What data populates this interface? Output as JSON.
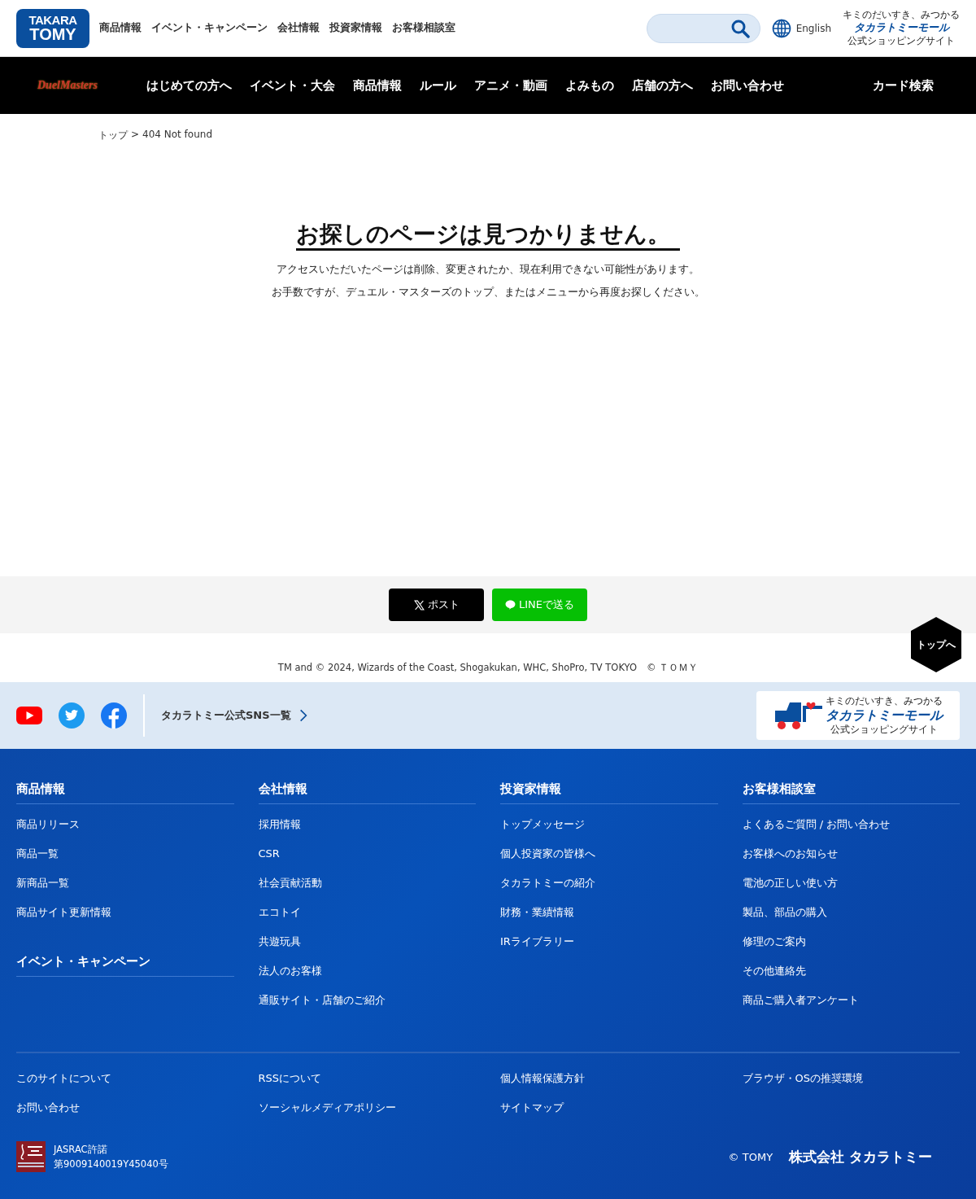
{
  "header": {
    "logo": [
      "TAKARA",
      "TOMY"
    ],
    "nav": [
      "商品情報",
      "イベント・キャンペーン",
      "会社情報",
      "投資家情報",
      "お客様相談室"
    ],
    "language": "English",
    "mall_logo": {
      "tagline": "キミのだいすき、みつかる",
      "name": "タカラトミーモール",
      "sub": "公式ショッピングサイト"
    }
  },
  "main_nav": {
    "logo": "DuelMasters",
    "items": [
      "はじめての方へ",
      "イベント・大会",
      "商品情報",
      "ルール",
      "アニメ・動画",
      "よみもの",
      "店舗の方へ",
      "お問い合わせ"
    ],
    "card_search": "カード検索"
  },
  "breadcrumb": {
    "items": [
      "トップ",
      "404 Not found"
    ],
    "separator": ">"
  },
  "error": {
    "title": "お探しのページは見つかりません。",
    "lines": [
      "アクセスいただいたページは削除、変更されたか、現在利用できない可能性があります。",
      "お手数ですが、デュエル・マスターズのトップ、またはメニューから再度お探しください。"
    ]
  },
  "share": [
    {
      "kind": "x",
      "label": "ポスト"
    },
    {
      "kind": "line",
      "label": "LINEで送る"
    }
  ],
  "back_to_top": "トップへ",
  "copyright": "TM and © 2024, Wizards of the Coast, Shogakukan, WHC, ShoPro, TV TOKYO　© ＴＯＭＹ",
  "sns": {
    "link": "タカラトミー公式SNS一覧",
    "mall_logo": {
      "tagline": "キミのだいすき、みつかる",
      "name": "タカラトミーモール",
      "sub": "公式ショッピングサイト"
    }
  },
  "footer": {
    "columns": [
      {
        "sections": [
          {
            "heading": "商品情報",
            "links": [
              "商品リリース",
              "商品一覧",
              "新商品一覧",
              "商品サイト更新情報"
            ]
          },
          {
            "heading": "イベント・キャンペーン"
          }
        ]
      },
      {
        "sections": [
          {
            "heading": "会社情報",
            "links": [
              "採用情報",
              "CSR",
              "社会貢献活動",
              "エコトイ",
              "共遊玩具",
              "法人のお客様",
              "通販サイト・店舗のご紹介"
            ]
          }
        ]
      },
      {
        "sections": [
          {
            "heading": "投資家情報",
            "links": [
              "トップメッセージ",
              "個人投資家の皆様へ",
              "タカラトミーの紹介",
              "財務・業績情報",
              "IRライブラリー"
            ]
          }
        ]
      },
      {
        "sections": [
          {
            "heading": "お客様相談室",
            "links": [
              "よくあるご質問 / お問い合わせ",
              "お客様へのお知らせ",
              "電池の正しい使い方",
              "製品、部品の購入",
              "修理のご案内",
              "その他連絡先",
              "商品ご購入者アンケート"
            ]
          }
        ]
      }
    ],
    "bottom_links": [
      [
        "このサイトについて",
        "お問い合わせ"
      ],
      [
        "RSSについて",
        "ソーシャルメディアポリシー"
      ],
      [
        "個人情報保護方針",
        "サイトマップ"
      ],
      [
        "ブラウザ・OSの推奨環境"
      ]
    ],
    "jasrac": [
      "JASRAC許諾",
      "第9009140019Y45040号"
    ],
    "copyright": "© TOMY",
    "company": "株式会社 タカラトミー"
  }
}
